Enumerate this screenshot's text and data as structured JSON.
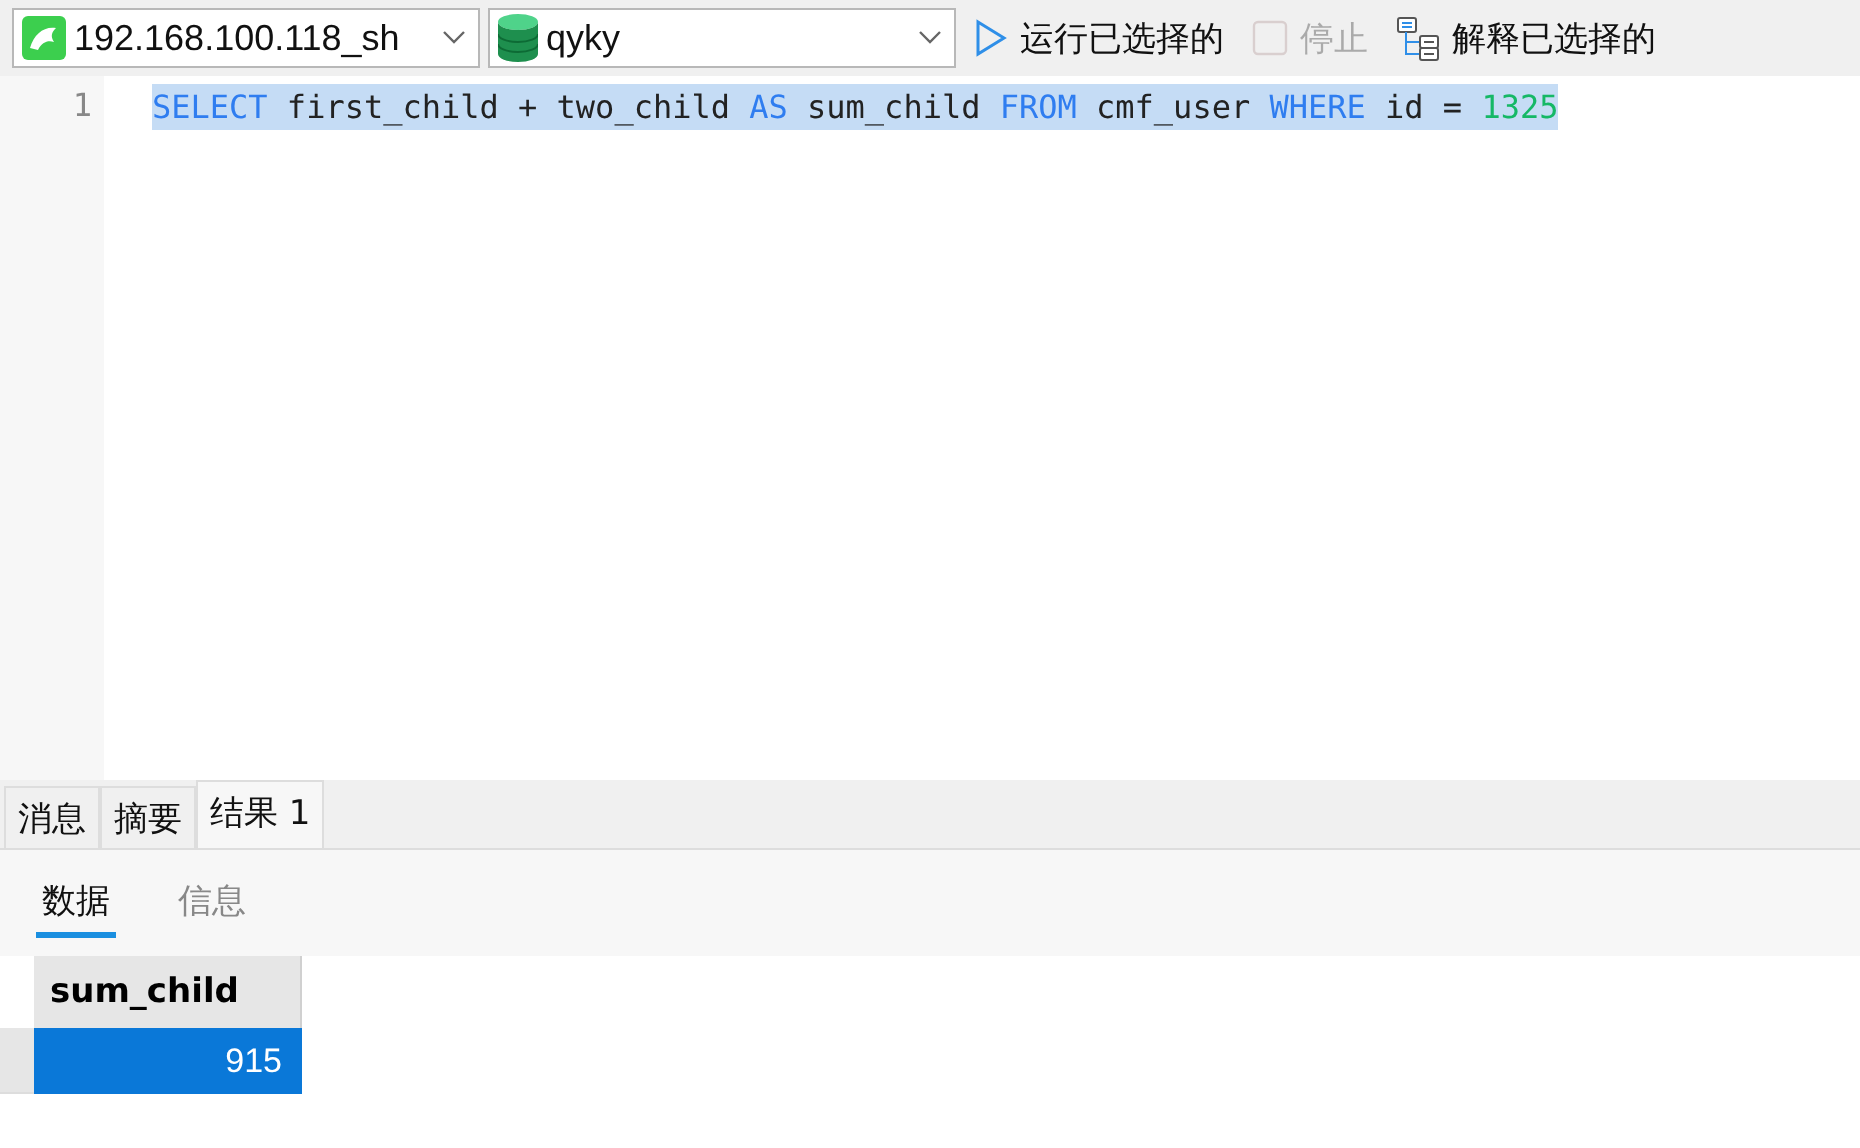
{
  "toolbar": {
    "connection": "192.168.100.118_sh",
    "database": "qyky",
    "buttons": [
      {
        "kind": "run",
        "label": "运行已选择的",
        "disabled": false
      },
      {
        "kind": "stop",
        "label": "停止",
        "disabled": true
      },
      {
        "kind": "explain",
        "label": "解释已选择的",
        "disabled": false
      }
    ]
  },
  "editor": {
    "lines": [
      {
        "number": "1",
        "selected": true,
        "tokens": [
          {
            "kind": "keyword",
            "text": "SELECT"
          },
          {
            "kind": "plain",
            "text": " first_child + two_child "
          },
          {
            "kind": "keyword",
            "text": "AS"
          },
          {
            "kind": "plain",
            "text": " sum_child "
          },
          {
            "kind": "keyword",
            "text": "FROM"
          },
          {
            "kind": "plain",
            "text": " cmf_user "
          },
          {
            "kind": "keyword",
            "text": "WHERE"
          },
          {
            "kind": "plain",
            "text": " id = "
          },
          {
            "kind": "number",
            "text": "1325"
          }
        ]
      }
    ]
  },
  "result_tabs": [
    {
      "label": "消息",
      "selected": false
    },
    {
      "label": "摘要",
      "selected": false
    },
    {
      "label": "结果 1",
      "selected": true
    }
  ],
  "view_tabs": [
    {
      "label": "数据",
      "selected": true
    },
    {
      "label": "信息",
      "selected": false
    }
  ],
  "table": {
    "columns": [
      "sum_child"
    ],
    "rows": [
      {
        "cells": [
          "915"
        ],
        "selected": true
      }
    ]
  }
}
